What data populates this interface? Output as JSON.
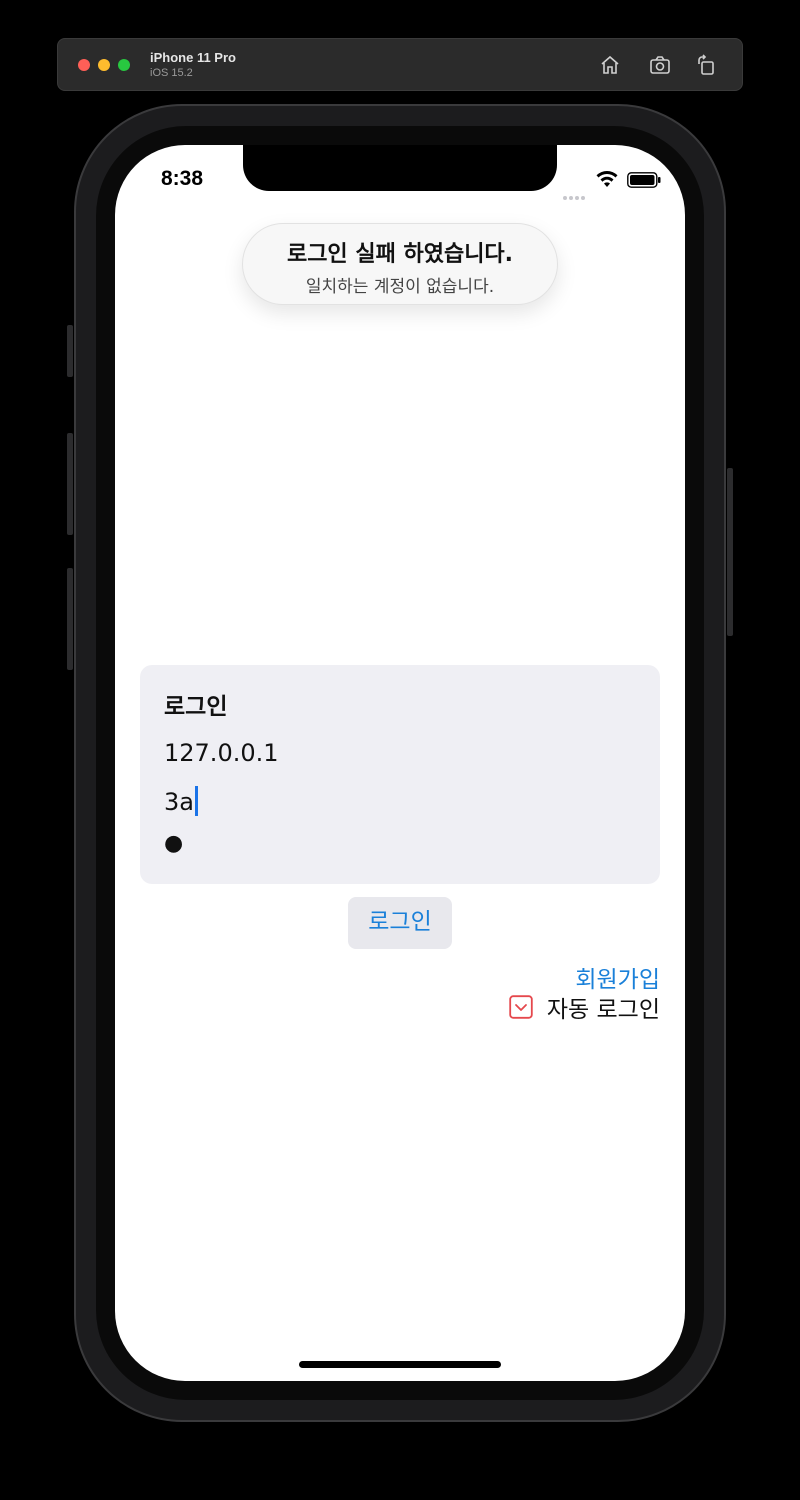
{
  "simulator": {
    "device_name": "iPhone 11 Pro",
    "os_version": "iOS 15.2"
  },
  "status_bar": {
    "time": "8:38"
  },
  "toast": {
    "title": "로그인 실패 하였습니다.",
    "message": "일치하는 계정이 없습니다."
  },
  "login_form": {
    "title": "로그인",
    "server_value": "127.0.0.1",
    "id_value": "3a",
    "password_value": "●"
  },
  "actions": {
    "login_label": "로그인",
    "signup_label": "회원가입",
    "auto_login_label": "자동 로그인"
  },
  "colors": {
    "link_blue": "#1a80d9",
    "checkbox_red": "#e5484d",
    "card_background": "#efeff4"
  }
}
